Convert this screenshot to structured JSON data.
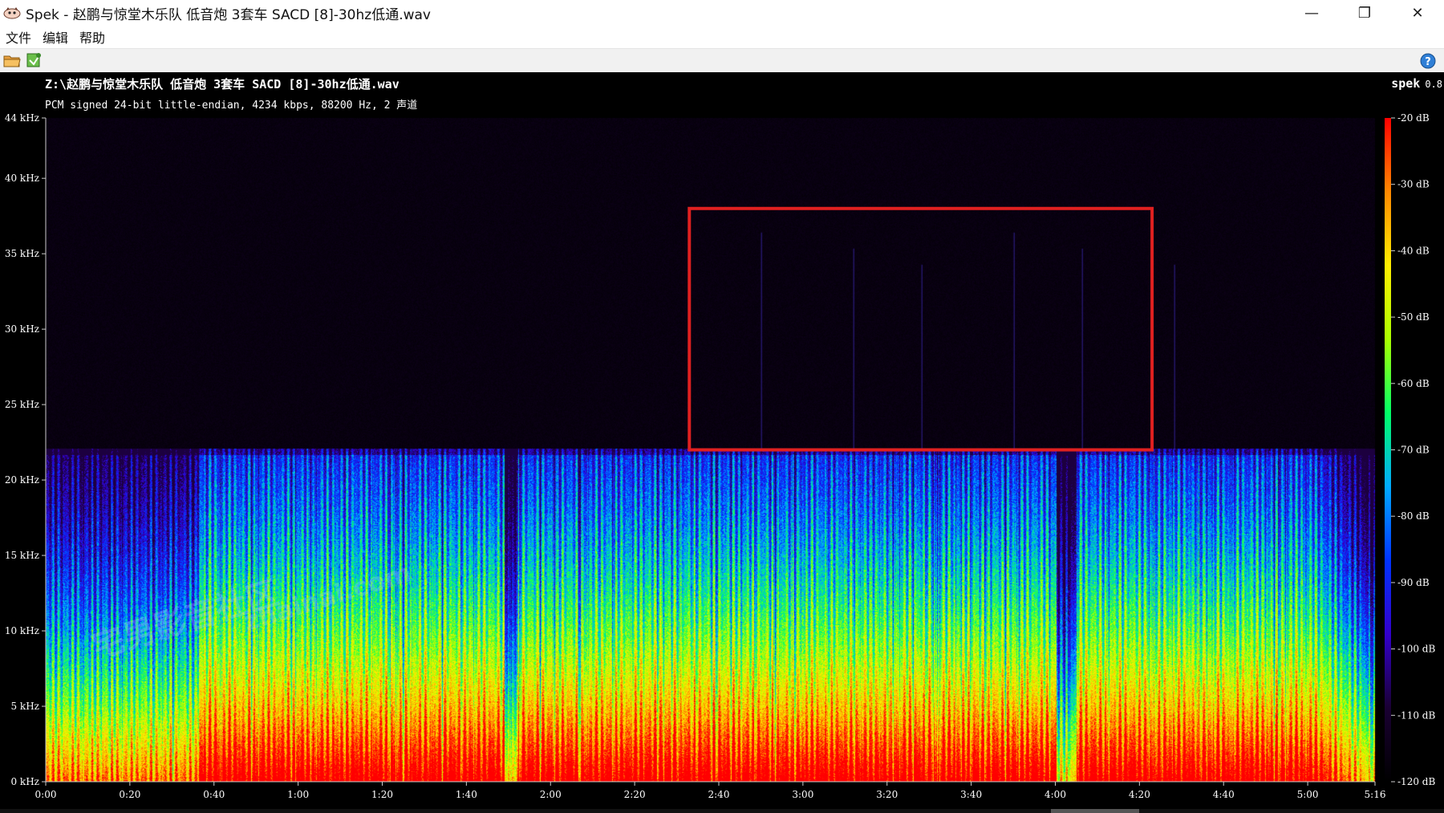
{
  "window": {
    "title": "Spek - 赵鹏与惊堂木乐队 低音炮 3套车 SACD [8]-30hz低通.wav",
    "controls": {
      "minimize": "—",
      "restore": "❐",
      "close": "✕"
    }
  },
  "menu": [
    "文件",
    "编辑",
    "帮助"
  ],
  "toolbar": {
    "open_icon": "open-file-icon",
    "save_icon": "save-icon",
    "help_icon": "help-icon"
  },
  "spek": {
    "file_path": "Z:\\赵鹏与惊堂木乐队 低音炮 3套车 SACD [8]-30hz低通.wav",
    "file_info": "PCM signed 24-bit little-endian, 4234 kbps, 88200 Hz, 2 声道",
    "brand_name": "spek",
    "brand_version": "0.8"
  },
  "watermark": {
    "url": "zhainai.com",
    "text": "宅男影音社区"
  },
  "chart_data": {
    "type": "heatmap",
    "x_axis": {
      "unit": "time",
      "range": [
        "0:00",
        "5:16"
      ],
      "tick_labels": [
        "0:00",
        "0:20",
        "0:40",
        "1:00",
        "1:20",
        "1:40",
        "2:00",
        "2:20",
        "2:40",
        "3:00",
        "3:20",
        "3:40",
        "4:00",
        "4:20",
        "4:40",
        "5:00",
        "5:16"
      ]
    },
    "y_axis": {
      "unit": "kHz",
      "range": [
        0,
        44
      ],
      "tick_labels": [
        "0 kHz",
        "5 kHz",
        "10 kHz",
        "15 kHz",
        "20 kHz",
        "25 kHz",
        "30 kHz",
        "35 kHz",
        "40 kHz",
        "44 kHz"
      ]
    },
    "color_scale": {
      "range_db": [
        -120,
        -20
      ],
      "tick_labels": [
        "-20 dB",
        "-30 dB",
        "-40 dB",
        "-50 dB",
        "-60 dB",
        "-70 dB",
        "-80 dB",
        "-90 dB",
        "-100 dB",
        "-110 dB",
        "-120 dB"
      ],
      "colors": [
        "#000000",
        "#1a0033",
        "#3300cc",
        "#0033ff",
        "#00aaff",
        "#00ff66",
        "#aaff00",
        "#ffee00",
        "#ff8800",
        "#ff0000"
      ]
    },
    "content_cutoff_khz": 22,
    "highlight_region": {
      "time_range": [
        "2:33",
        "4:23"
      ],
      "freq_range_khz": [
        22,
        38
      ],
      "color": "#e02020"
    }
  }
}
